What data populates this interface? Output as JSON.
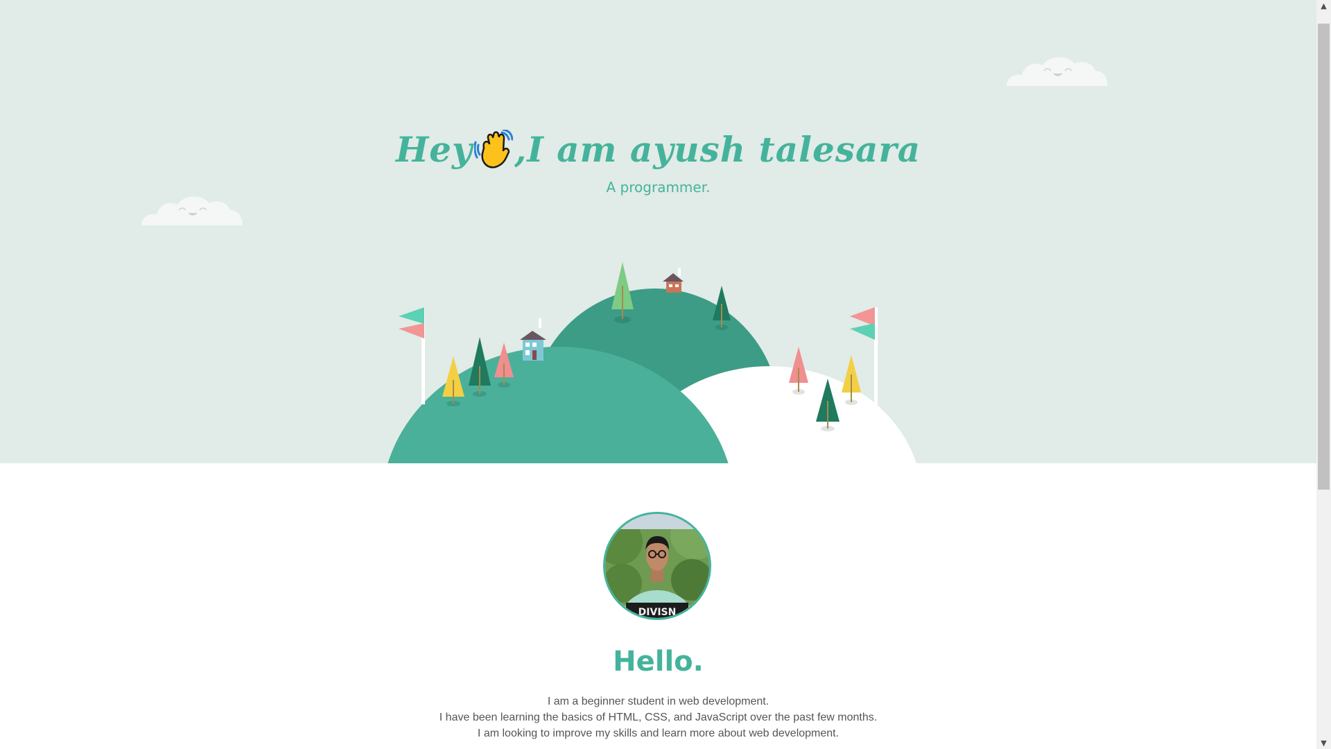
{
  "hero": {
    "title_prefix": "Hey",
    "wave_icon": "waving-hand-icon",
    "title_suffix": ",I am ayush talesara",
    "subtitle": "A programmer."
  },
  "about": {
    "avatar_icon": "profile-photo",
    "avatar_shirt_text": "DIVISN",
    "heading": "Hello.",
    "bio_lines": [
      "I am a beginner student in web development.",
      "I have been learning the basics of HTML, CSS, and JavaScript over the past few months.",
      "I am looking to improve my skills and learn more about web development."
    ]
  },
  "scrollbar": {
    "up_arrow": "▲",
    "down_arrow": "▼"
  },
  "colors": {
    "hero_bg": "#e1ebe7",
    "accent": "#45b39c",
    "hill_dark": "#3d9c86",
    "tree_dark": "#1f7a5e",
    "tree_yellow": "#f3cf43",
    "tree_pink": "#f08f8f",
    "tree_light": "#7ecb84",
    "flag_teal": "#5cd1b3",
    "flag_pink": "#f29595"
  }
}
